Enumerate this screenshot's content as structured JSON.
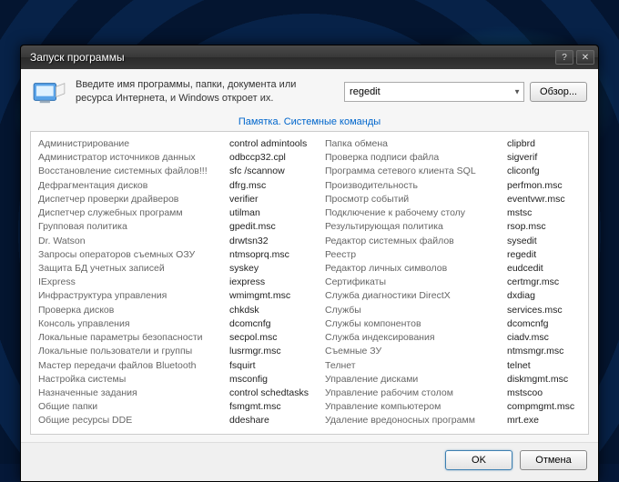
{
  "window": {
    "title": "Запуск программы",
    "help_glyph": "?",
    "close_glyph": "✕"
  },
  "header": {
    "description": "Введите имя программы, папки, документа или ресурса Интернета, и Windows откроет их.",
    "input_value": "regedit",
    "browse_label": "Обзор..."
  },
  "memo_link": "Памятка. Системные команды",
  "columns": {
    "names1": [
      "Администрирование",
      "Администратор источников данных",
      "Восстановление системных файлов!!!",
      "Дефрагментация дисков",
      "Диспетчер проверки драйверов",
      "Диспетчер служебных программ",
      "Групповая политика",
      "Dr. Watson",
      "Запросы операторов съемных ОЗУ",
      "Защита БД учетных записей",
      "IExpress",
      "Инфраструктура управления",
      "Проверка дисков",
      "Консоль управления",
      "Локальные параметры безопасности",
      "Локальные пользователи и группы",
      "Мастер передачи файлов Bluetooth",
      "Настройка системы",
      "Назначенные задания",
      "Общие папки",
      "Общие ресурсы DDE"
    ],
    "cmds1": [
      "control admintools",
      "odbccp32.cpl",
      "sfc /scannow",
      "dfrg.msc",
      "verifier",
      "utilman",
      "gpedit.msc",
      "drwtsn32",
      "ntmsoprq.msc",
      "syskey",
      "iexpress",
      "wmimgmt.msc",
      "chkdsk",
      "dcomcnfg",
      "secpol.msc",
      "lusrmgr.msc",
      "fsquirt",
      "msconfig",
      "control schedtasks",
      "fsmgmt.msc",
      "ddeshare"
    ],
    "names2": [
      "Папка обмена",
      "Проверка подписи файла",
      "Программа сетевого клиента SQL",
      "Производительность",
      "Просмотр событий",
      "Подключение к рабочему столу",
      "Результирующая политика",
      "Редактор системных файлов",
      "Реестр",
      "Редактор личных символов",
      "Сертификаты",
      "Служба диагностики DirectX",
      "Службы",
      "Службы компонентов",
      "Служба индексирования",
      "Съемные ЗУ",
      "Телнет",
      "Управление дисками",
      "Управление рабочим столом",
      "Управление компьютером",
      "Удаление вредоносных программ"
    ],
    "cmds2": [
      "clipbrd",
      "sigverif",
      "cliconfg",
      "perfmon.msc",
      "eventvwr.msc",
      "mstsc",
      "rsop.msc",
      "sysedit",
      "regedit",
      "eudcedit",
      "certmgr.msc",
      "dxdiag",
      "services.msc",
      "dcomcnfg",
      "ciadv.msc",
      "ntmsmgr.msc",
      "telnet",
      "diskmgmt.msc",
      "mstscoo",
      "compmgmt.msc",
      "mrt.exe"
    ]
  },
  "footer": {
    "ok": "OK",
    "cancel": "Отмена"
  }
}
